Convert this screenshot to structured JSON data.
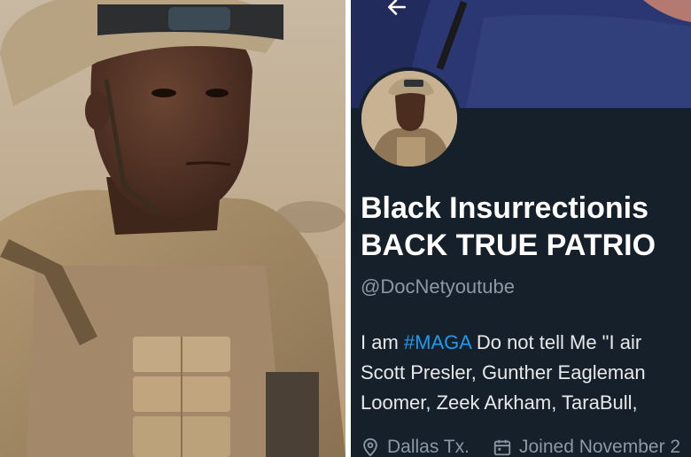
{
  "photo": {
    "subject": "soldier-photo"
  },
  "profile": {
    "display_name_line1": "Black Insurrectionis",
    "display_name_line2": "BACK TRUE PATRIO",
    "handle": "@DocNetyoutube",
    "bio": {
      "line1_prefix": "I am ",
      "line1_hashtag": "#MAGA",
      "line1_suffix": " Do not tell Me \"I air",
      "line2": "Scott Presler, Gunther Eagleman",
      "line3": "Loomer, Zeek Arkham, TaraBull,"
    },
    "location": "Dallas Tx.",
    "joined": "Joined November 2"
  },
  "icons": {
    "back": "arrow-left-icon",
    "location": "location-pin-icon",
    "calendar": "calendar-icon"
  },
  "colors": {
    "background": "#15202b",
    "text": "#e7e9ea",
    "muted": "#8b98a5",
    "link": "#1d9bf0"
  }
}
